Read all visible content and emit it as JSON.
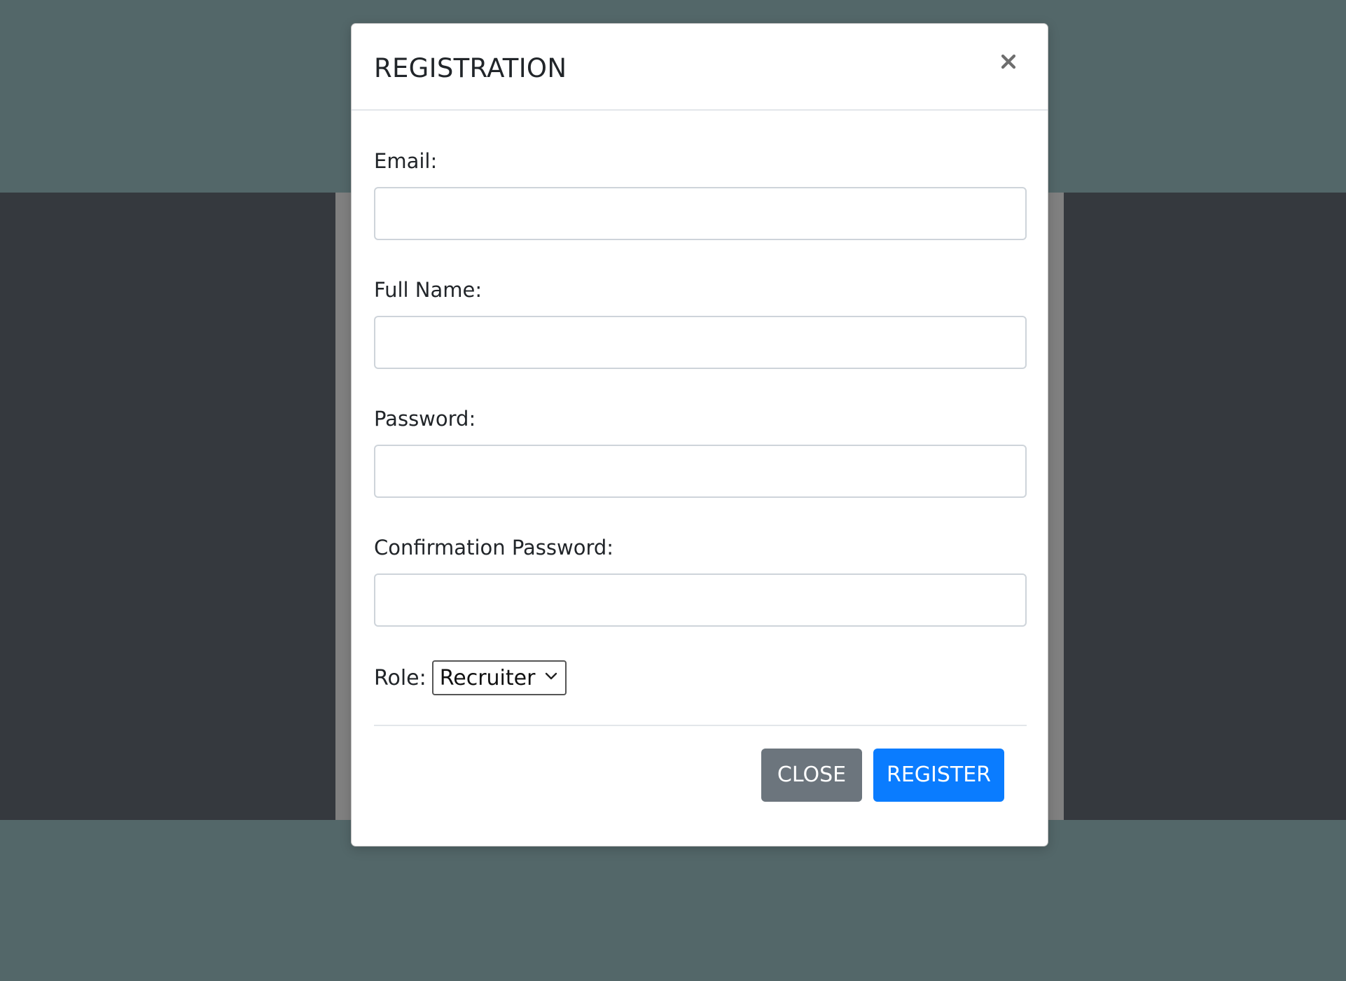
{
  "colors": {
    "page_background": "#536769",
    "band_background": "#35393e",
    "panel_background": "#808080",
    "close_button": "#6c757d",
    "register_button": "#0a7cff"
  },
  "modal": {
    "title": "REGISTRATION",
    "close_icon": "close-icon"
  },
  "form": {
    "email_label": "Email:",
    "email_value": "",
    "full_name_label": "Full Name:",
    "full_name_value": "",
    "password_label": "Password:",
    "password_value": "",
    "confirm_password_label": "Confirmation Password:",
    "confirm_password_value": "",
    "role_label": "Role:",
    "role_selected": "Recruiter",
    "role_icon": "chevron-down-icon"
  },
  "footer": {
    "close_label": "CLOSE",
    "register_label": "REGISTER"
  }
}
